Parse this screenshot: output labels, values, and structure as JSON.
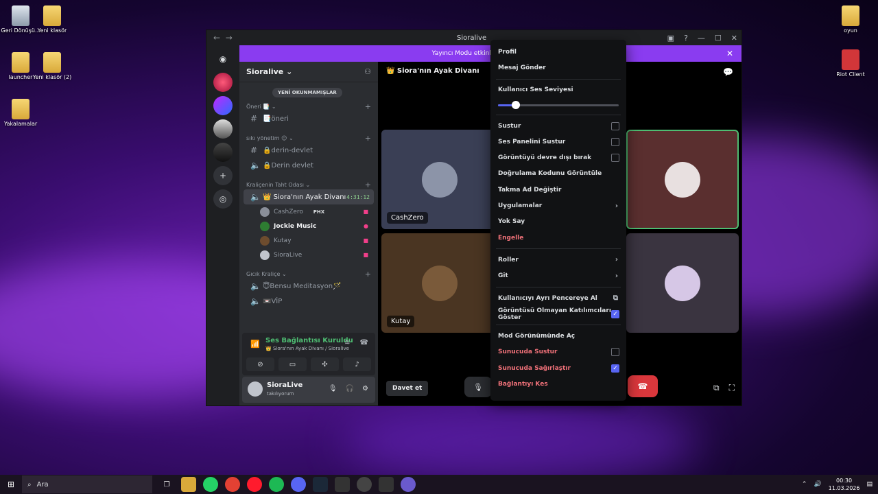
{
  "desktop": {
    "icons_left": [
      {
        "label": "Geri Dönüşü..."
      },
      {
        "label": "Yeni klasör"
      },
      {
        "label": "launcher"
      },
      {
        "label": "Yeni klasör (2)"
      },
      {
        "label": "Yakalamalar"
      }
    ],
    "icons_right": [
      {
        "label": "oyun"
      },
      {
        "label": "Riot Client"
      }
    ]
  },
  "window": {
    "title": "Sioralive",
    "banner": "Yayıncı Modu etkinleştirildi. Kullanıcı a",
    "banner_close": "✕",
    "controls": {
      "minimize": "—",
      "maximize": "☐",
      "close": "✕"
    },
    "nav": {
      "back": "←",
      "forward": "→"
    }
  },
  "server": {
    "name": "Sioralive",
    "unread_pill": "YENİ OKUNMAMIŞLAR",
    "categories": [
      {
        "label": "Öneri 📑",
        "channels": [
          {
            "type": "text",
            "name": "📑öneri"
          }
        ]
      },
      {
        "label": "sıkı yönetim 😉",
        "channels": [
          {
            "type": "text",
            "name": "🔒derin-devlet"
          },
          {
            "type": "voice",
            "name": "🔒Derin devlet"
          }
        ]
      },
      {
        "label": "Kraliçenin Taht Odası",
        "channels": [
          {
            "type": "voice",
            "name": "👑 Siora'nın Ayak Divanı",
            "active": true,
            "time": "4:31:12"
          }
        ]
      },
      {
        "label": "Gıcık Kraliçe",
        "channels": [
          {
            "type": "voice",
            "name": "😇Bensu Meditasyon🪄"
          },
          {
            "type": "voice",
            "name": "📼VİP"
          }
        ]
      }
    ],
    "members": [
      {
        "name": "CashZero",
        "tag": "PHX",
        "bold": false
      },
      {
        "name": "Jockie Music",
        "bold": true
      },
      {
        "name": "Kutay",
        "bold": false
      },
      {
        "name": "SioraLive",
        "bold": false
      }
    ]
  },
  "voice_panel": {
    "status": "Ses Bağlantısı Kuruldu",
    "sub": "👑 Siora'nın Ayak Divanı / Sioralive"
  },
  "user_panel": {
    "name": "SioraLive",
    "status": "takılıyorum"
  },
  "stage": {
    "header": "👑 Siora'nın Ayak Divanı",
    "tiles": [
      {
        "name": "CashZero"
      },
      {
        "name": "Kutay"
      }
    ],
    "invite": "Davet et"
  },
  "context_menu": {
    "profile": "Profil",
    "message": "Mesaj Gönder",
    "volume_label": "Kullanıcı Ses Seviyesi",
    "volume_fraction": 0.15,
    "mute": "Sustur",
    "mute_soundboard": "Ses Panelini Sustur",
    "disable_video": "Görüntüyü devre dışı bırak",
    "verify": "Doğrulama Kodunu Görüntüle",
    "nickname": "Takma Ad Değiştir",
    "apps": "Uygulamalar",
    "ignore": "Yok Say",
    "block": "Engelle",
    "roles": "Roller",
    "go": "Git",
    "popout": "Kullanıcıyı Ayrı Pencereye Al",
    "show_nonvideo": "Görüntüsü Olmayan Katılımcıları Göster",
    "mod_view": "Mod Görünümünde Aç",
    "server_mute": "Sunucuda Sustur",
    "server_deafen": "Sunucuda Sağırlaştır",
    "disconnect": "Bağlantıyı Kes"
  },
  "taskbar": {
    "search": "Ara",
    "time": "00:30",
    "date": "11.03.2026"
  },
  "colors": {
    "accent": "#5865f2",
    "banner": "#8a3cf0",
    "danger": "#da373c",
    "online": "#4ebd72"
  }
}
